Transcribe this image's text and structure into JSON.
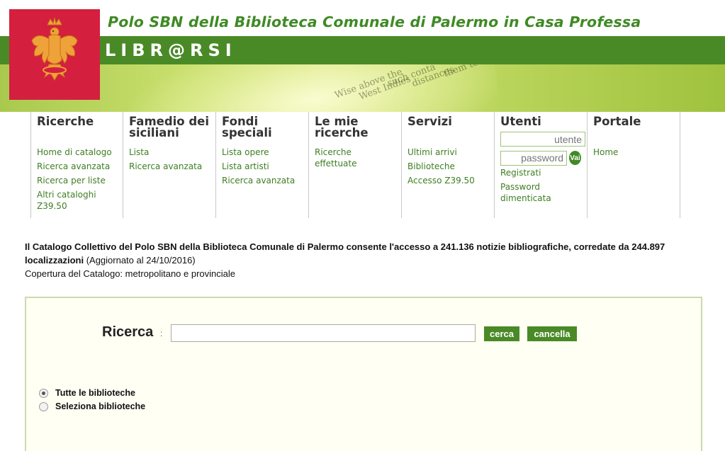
{
  "header": {
    "site_title": "Polo SBN della Biblioteca Comunale di Palermo in Casa Professa",
    "brand": "LIBR@RSI",
    "logo": "eagle-crest-logo",
    "banner_words": [
      "Wise above the",
      "West Indies",
      "such conta",
      "distances",
      "them to"
    ]
  },
  "nav": {
    "ricerche": {
      "title": "Ricerche",
      "links": [
        "Home di catalogo",
        "Ricerca avanzata",
        "Ricerca per liste",
        "Altri cataloghi Z39.50"
      ]
    },
    "famedio": {
      "title": "Famedio dei siciliani",
      "links": [
        "Lista",
        "Ricerca avanzata"
      ]
    },
    "fondi": {
      "title": "Fondi speciali",
      "links": [
        "Lista opere",
        "Lista artisti",
        "Ricerca avanzata"
      ]
    },
    "mie": {
      "title": "Le mie ricerche",
      "links": [
        "Ricerche effettuate"
      ]
    },
    "servizi": {
      "title": "Servizi",
      "links": [
        "Ultimi arrivi",
        "Biblioteche",
        "Accesso Z39.50"
      ]
    },
    "utenti": {
      "title": "Utenti",
      "user_placeholder": "utente",
      "password_placeholder": "password",
      "go_label": "Vai",
      "links": [
        "Registrati",
        "Password dimenticata"
      ]
    },
    "portale": {
      "title": "Portale",
      "links": [
        "Home"
      ]
    }
  },
  "info": {
    "line1_bold": "Il Catalogo Collettivo del Polo SBN della Biblioteca Comunale di Palermo consente l'accesso a 241.136 notizie bibliografiche, corredate da 244.897 localizzazioni",
    "line1_suffix": " (Aggiornato al 24/10/2016)",
    "line2": "Copertura del Catalogo: metropolitano e provinciale"
  },
  "search": {
    "label": "Ricerca",
    "colon": ":",
    "input_value": "",
    "search_button": "cerca",
    "clear_button": "cancella",
    "options": [
      {
        "label": "Tutte le biblioteche",
        "checked": true
      },
      {
        "label": "Seleziona biblioteche",
        "checked": false
      }
    ]
  },
  "colors": {
    "brand_green": "#4a8a26",
    "title_green": "#3f8a25",
    "logo_red": "#d41f3f",
    "link_green": "#3e7e22"
  }
}
